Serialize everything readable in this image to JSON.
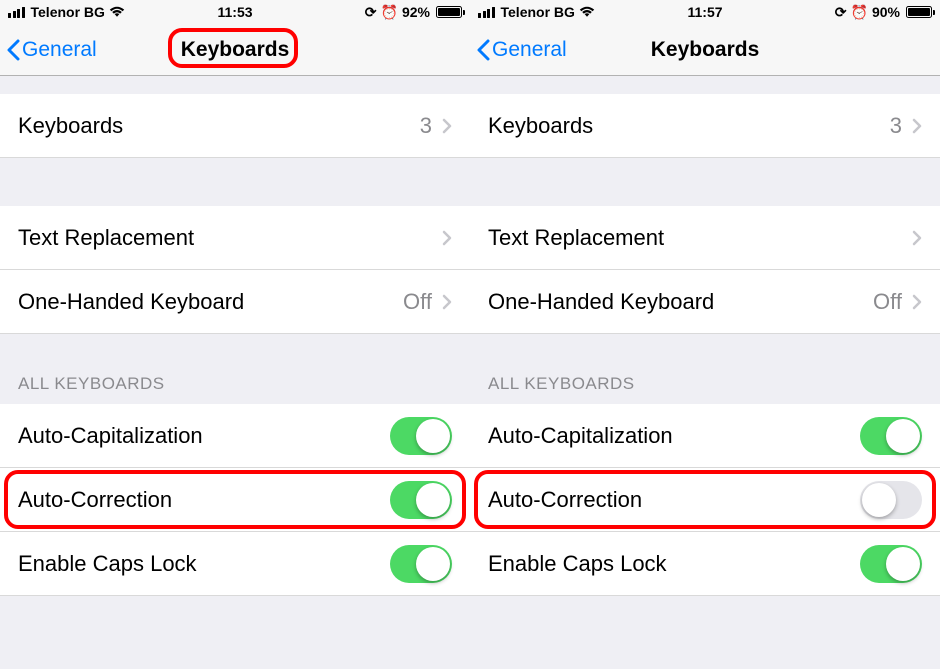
{
  "left": {
    "status": {
      "carrier": "Telenor BG",
      "time": "11:53",
      "battery_pct": "92%",
      "battery_fill": 0.92
    },
    "nav": {
      "back": "General",
      "title": "Keyboards"
    },
    "rows": {
      "keyboards": {
        "label": "Keyboards",
        "value": "3"
      },
      "text_replacement": {
        "label": "Text Replacement"
      },
      "one_handed": {
        "label": "One-Handed Keyboard",
        "value": "Off"
      }
    },
    "section_header": "ALL KEYBOARDS",
    "toggles": {
      "auto_cap": {
        "label": "Auto-Capitalization",
        "on": true
      },
      "auto_corr": {
        "label": "Auto-Correction",
        "on": true
      },
      "caps_lock": {
        "label": "Enable Caps Lock",
        "on": true
      }
    },
    "highlights": {
      "title": true,
      "auto_corr": true
    }
  },
  "right": {
    "status": {
      "carrier": "Telenor BG",
      "time": "11:57",
      "battery_pct": "90%",
      "battery_fill": 0.9
    },
    "nav": {
      "back": "General",
      "title": "Keyboards"
    },
    "rows": {
      "keyboards": {
        "label": "Keyboards",
        "value": "3"
      },
      "text_replacement": {
        "label": "Text Replacement"
      },
      "one_handed": {
        "label": "One-Handed Keyboard",
        "value": "Off"
      }
    },
    "section_header": "ALL KEYBOARDS",
    "toggles": {
      "auto_cap": {
        "label": "Auto-Capitalization",
        "on": true
      },
      "auto_corr": {
        "label": "Auto-Correction",
        "on": false
      },
      "caps_lock": {
        "label": "Enable Caps Lock",
        "on": true
      }
    },
    "highlights": {
      "title": false,
      "auto_corr": true
    }
  }
}
